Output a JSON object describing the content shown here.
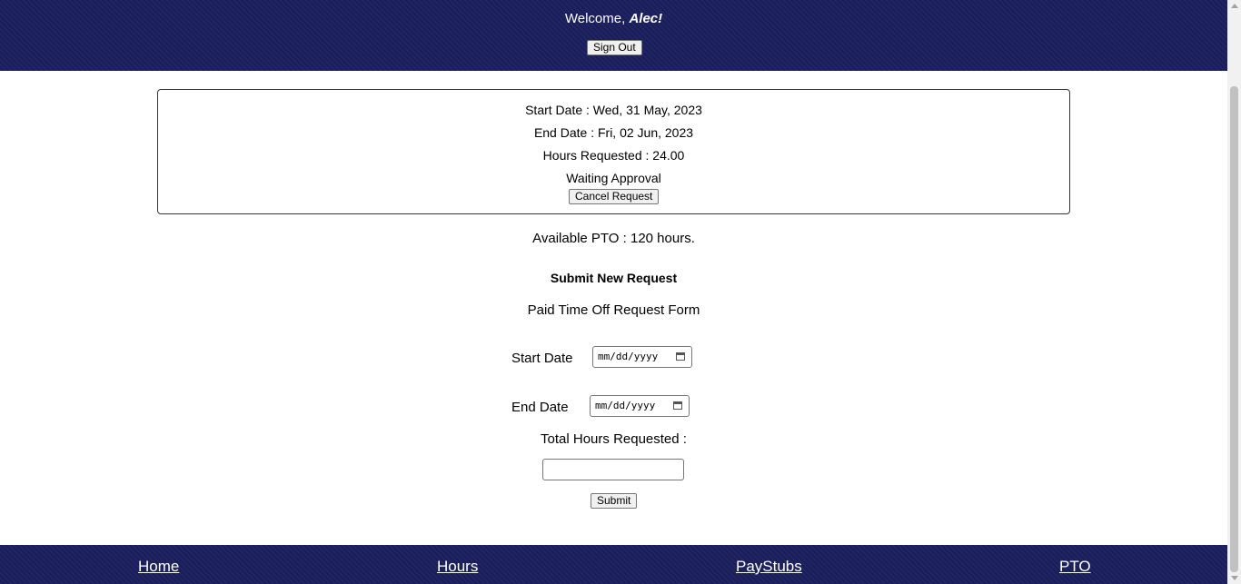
{
  "header": {
    "welcome_prefix": "Welcome,",
    "user_name": "Alec!",
    "signout_label": "Sign Out"
  },
  "request": {
    "start_date": "Start Date : Wed, 31 May, 2023",
    "end_date": "End Date : Fri, 02 Jun, 2023",
    "hours": "Hours Requested : 24.00",
    "status": "Waiting Approval",
    "cancel_label": "Cancel Request"
  },
  "available_pto": "Available PTO : 120 hours.",
  "form": {
    "heading": "Submit New Request",
    "title": "Paid Time Off Request Form",
    "start_label": "Start Date",
    "start_placeholder": "mm/dd/yyyy",
    "end_label": "End Date",
    "end_placeholder": "mm/dd/yyyy",
    "hours_label": "Total Hours Requested :",
    "hours_value": "",
    "submit_label": "Submit"
  },
  "footer": {
    "links": [
      "Home",
      "Hours",
      "PayStubs",
      "PTO"
    ]
  },
  "colors": {
    "header_bg": "#1a1f5e",
    "footer_bg": "#1a1f5e"
  }
}
